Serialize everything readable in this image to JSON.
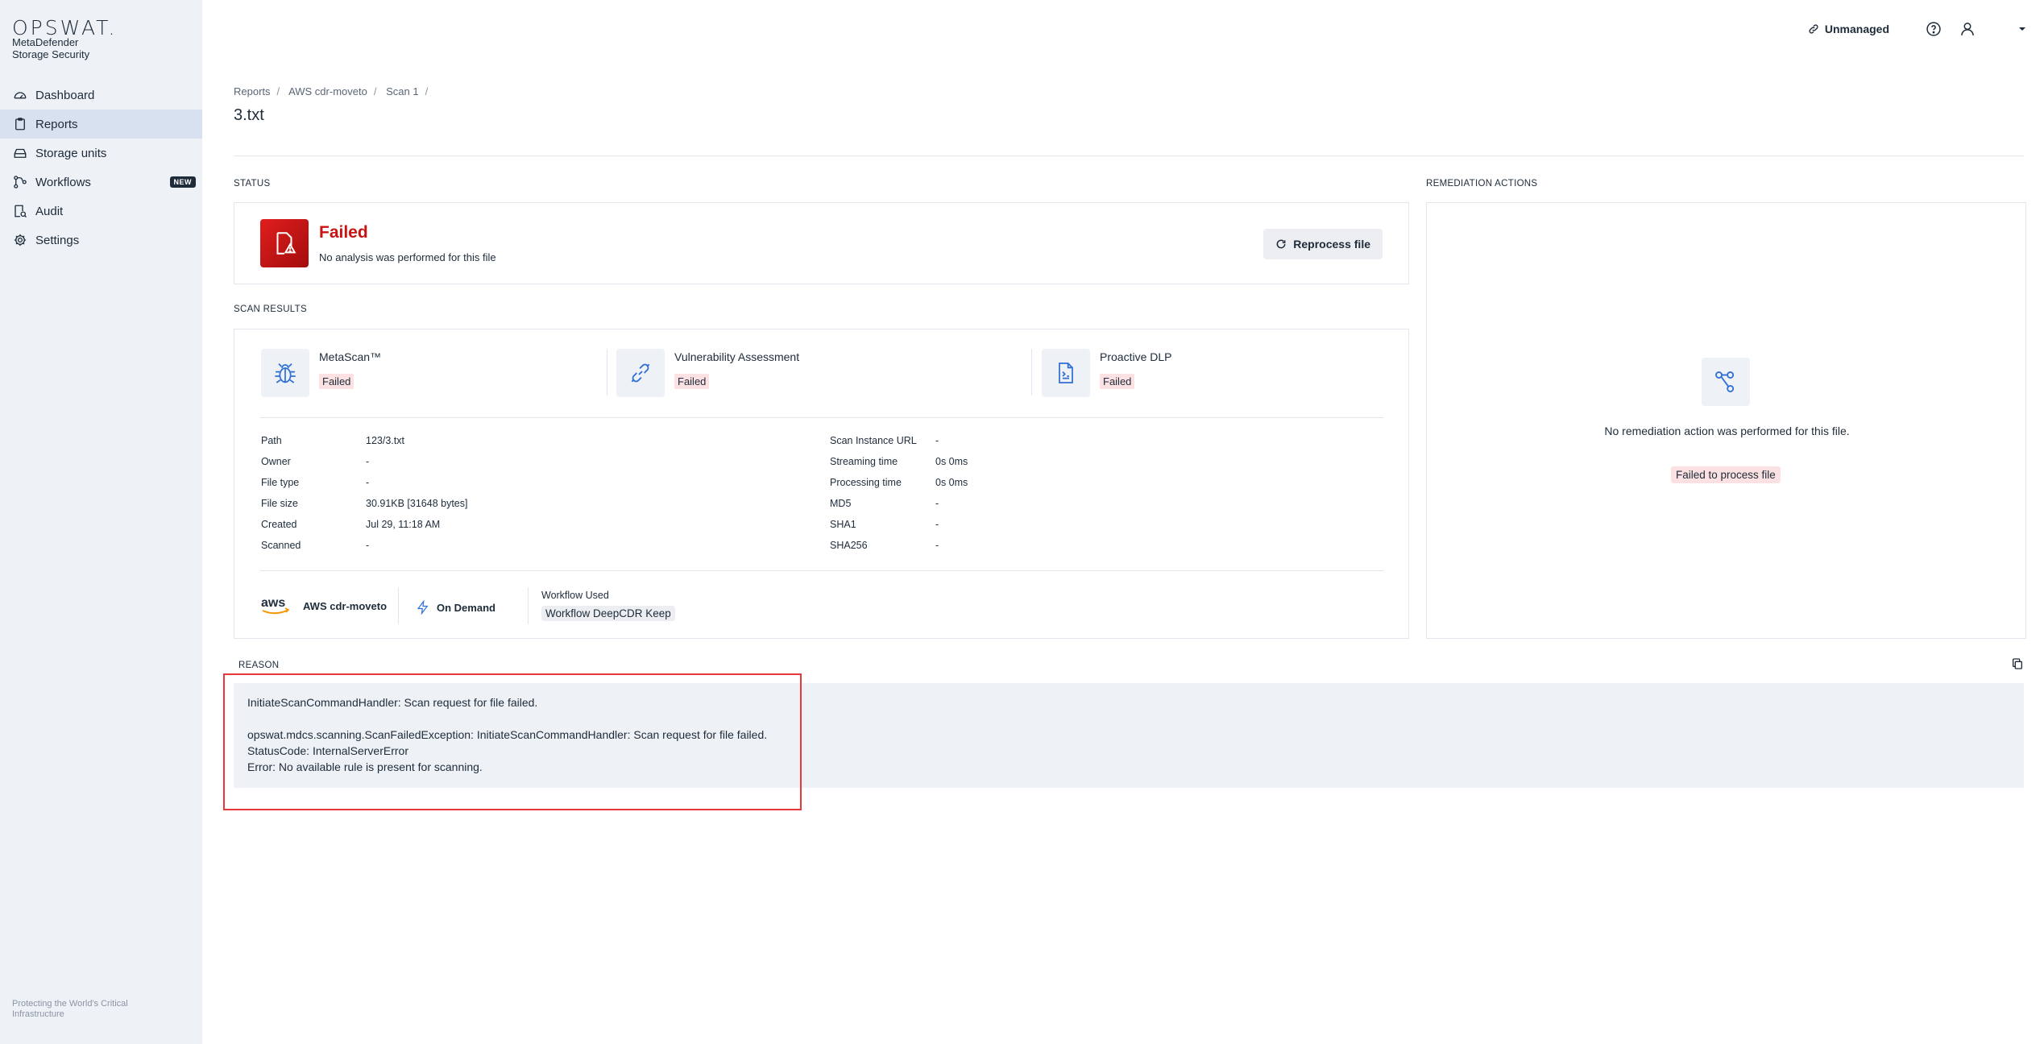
{
  "brand": {
    "wordmark": "OPSWAT.",
    "product_line1": "MetaDefender",
    "product_line2": "Storage Security"
  },
  "sidebar": {
    "items": [
      {
        "label": "Dashboard",
        "icon": "dashboard-icon"
      },
      {
        "label": "Reports",
        "icon": "clipboard-icon",
        "active": true
      },
      {
        "label": "Storage units",
        "icon": "storage-icon"
      },
      {
        "label": "Workflows",
        "icon": "workflow-icon",
        "badge": "NEW"
      },
      {
        "label": "Audit",
        "icon": "audit-icon"
      },
      {
        "label": "Settings",
        "icon": "gear-icon"
      }
    ],
    "footer": "Protecting the World's Critical Infrastructure"
  },
  "topbar": {
    "unmanaged": "Unmanaged"
  },
  "breadcrumb": [
    "Reports",
    "AWS cdr-moveto",
    "Scan 1"
  ],
  "page_title": "3.txt",
  "status": {
    "section_label": "STATUS",
    "title": "Failed",
    "description": "No analysis was performed for this file",
    "reprocess_label": "Reprocess file",
    "accent": "#c91313"
  },
  "scan_results": {
    "section_label": "SCAN RESULTS",
    "engines": [
      {
        "name": "MetaScan™",
        "status": "Failed",
        "icon": "bug-icon"
      },
      {
        "name": "Vulnerability Assessment",
        "status": "Failed",
        "icon": "link-icon"
      },
      {
        "name": "Proactive DLP",
        "status": "Failed",
        "icon": "document-icon"
      }
    ],
    "left_details": [
      {
        "key": "Path",
        "value": "123/3.txt"
      },
      {
        "key": "Owner",
        "value": "-"
      },
      {
        "key": "File type",
        "value": "-"
      },
      {
        "key": "File size",
        "value": "30.91KB [31648 bytes]"
      },
      {
        "key": "Created",
        "value": "Jul 29, 11:18 AM"
      },
      {
        "key": "Scanned",
        "value": "-"
      }
    ],
    "right_details": [
      {
        "key": "Scan Instance URL",
        "value": "-"
      },
      {
        "key": "Streaming time",
        "value": "0s 0ms"
      },
      {
        "key": "Processing time",
        "value": "0s 0ms"
      },
      {
        "key": "MD5",
        "value": "-"
      },
      {
        "key": "SHA1",
        "value": "-"
      },
      {
        "key": "SHA256",
        "value": "-"
      }
    ],
    "storage": {
      "logo": "aws",
      "name": "AWS cdr-moveto"
    },
    "scan_type": "On Demand",
    "workflow_label": "Workflow Used",
    "workflow_name": "Workflow DeepCDR Keep"
  },
  "remediation": {
    "section_label": "REMEDIATION ACTIONS",
    "message": "No remediation action was performed for this file.",
    "chip": "Failed to process file"
  },
  "reason": {
    "section_label": "REASON",
    "lines": [
      "InitiateScanCommandHandler: Scan request for file failed.",
      "opswat.mdcs.scanning.ScanFailedException: InitiateScanCommandHandler: Scan request for file failed.",
      "StatusCode: InternalServerError",
      "Error: No available rule is present for scanning."
    ]
  }
}
